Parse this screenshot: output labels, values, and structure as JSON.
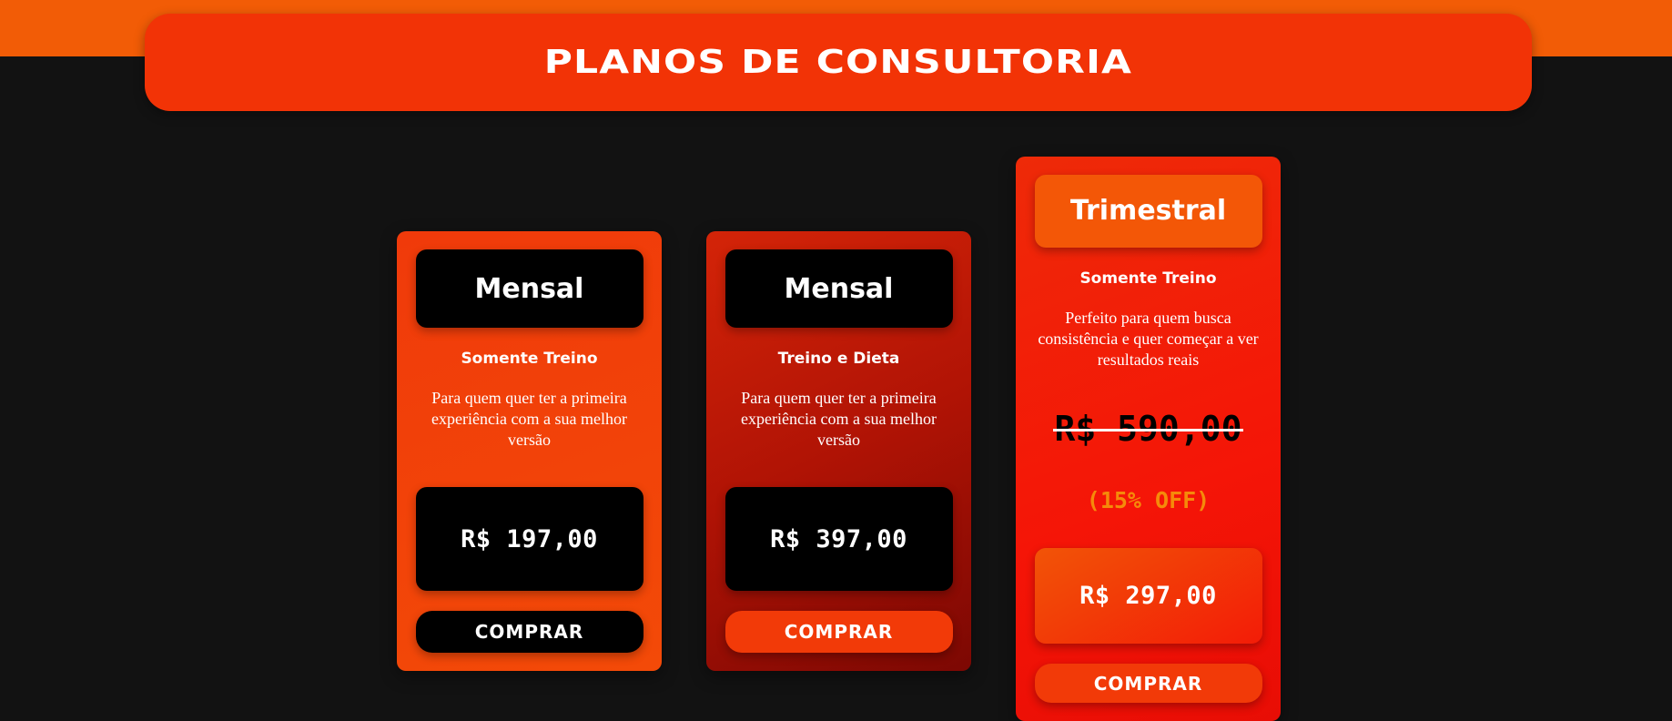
{
  "header": {
    "title": "PLANOS DE CONSULTORIA"
  },
  "colors": {
    "accent_orange": "#f25c06",
    "accent_red": "#f23306",
    "background": "#121212"
  },
  "plans": [
    {
      "name": "Mensal",
      "type": "Somente Treino",
      "description": "Para quem quer ter a primeira experiência com a sua melhor versão",
      "price": "R$ 197,00",
      "button_label": "COMPRAR"
    },
    {
      "name": "Mensal",
      "type": "Treino e Dieta",
      "description": "Para quem quer ter a primeira experiência com a sua melhor versão",
      "price": "R$ 397,00",
      "button_label": "COMPRAR"
    },
    {
      "name": "Trimestral",
      "type": "Somente Treino",
      "description": "Perfeito para quem busca consistência e quer começar a ver resultados reais",
      "old_price": "R$ 590,00",
      "discount": "(15% OFF)",
      "price": "R$ 297,00",
      "button_label": "COMPRAR"
    }
  ]
}
